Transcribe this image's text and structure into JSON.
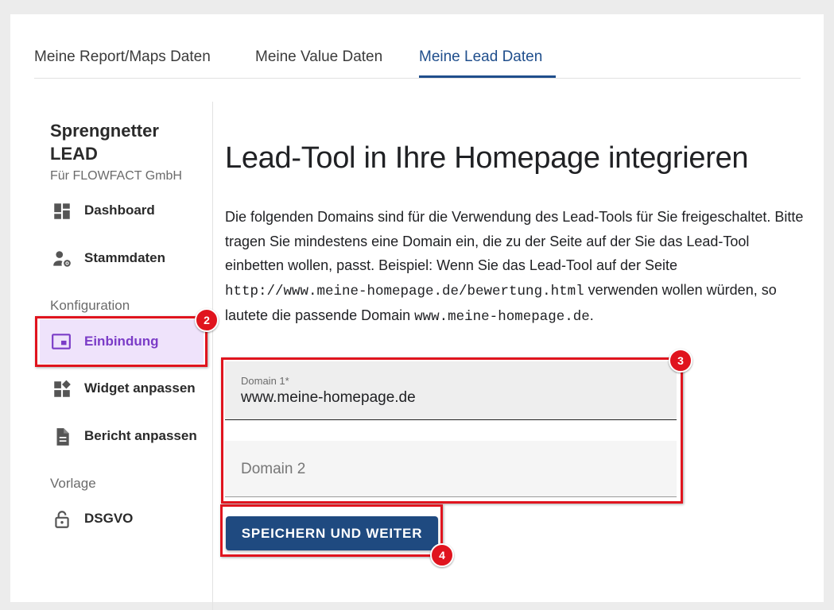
{
  "tabs": [
    {
      "label": "Meine Report/Maps Daten"
    },
    {
      "label": "Meine Value Daten"
    },
    {
      "label": "Meine Lead Daten"
    }
  ],
  "sidebar": {
    "title": "Sprengnetter LEAD",
    "subtitle": "Für FLOWFACT GmbH",
    "items": [
      {
        "label": "Dashboard",
        "icon": "dashboard-icon"
      },
      {
        "label": "Stammdaten",
        "icon": "user-settings-icon"
      }
    ],
    "section_konfiguration": "Konfiguration",
    "config_items": [
      {
        "label": "Einbindung",
        "icon": "embed-icon"
      },
      {
        "label": "Widget anpassen",
        "icon": "widgets-icon"
      },
      {
        "label": "Bericht anpassen",
        "icon": "document-icon"
      }
    ],
    "section_vorlage": "Vorlage",
    "template_items": [
      {
        "label": "DSGVO",
        "icon": "lock-open-icon"
      }
    ]
  },
  "main": {
    "title": "Lead-Tool in Ihre Homepage integrieren",
    "desc_1": "Die folgenden Domains sind für die Verwendung des Lead-Tools für Sie freigeschaltet. Bitte tragen Sie mindestens eine Domain ein, die zu der Seite auf der Sie das Lead-Tool einbetten wollen, passt. Beispiel: Wenn Sie das Lead-Tool auf der Seite ",
    "desc_code_1": "http://www.meine-homepage.de/bewertung.html",
    "desc_2": " verwenden wollen würden, so lautete die passende Domain ",
    "desc_code_2": "www.meine-homepage.de",
    "desc_3": ".",
    "domain1_label": "Domain 1*",
    "domain1_value": "www.meine-homepage.de",
    "domain2_placeholder": "Domain 2",
    "save_label": "SPEICHERN UND WEITER"
  },
  "annotations": [
    {
      "number": "2"
    },
    {
      "number": "3"
    },
    {
      "number": "4"
    }
  ],
  "colors": {
    "accent": "#1f4e8c",
    "button": "#1f4a80",
    "active_nav_bg": "#efe3fb",
    "active_nav_text": "#7b3cc7",
    "highlight": "#e0141e"
  }
}
